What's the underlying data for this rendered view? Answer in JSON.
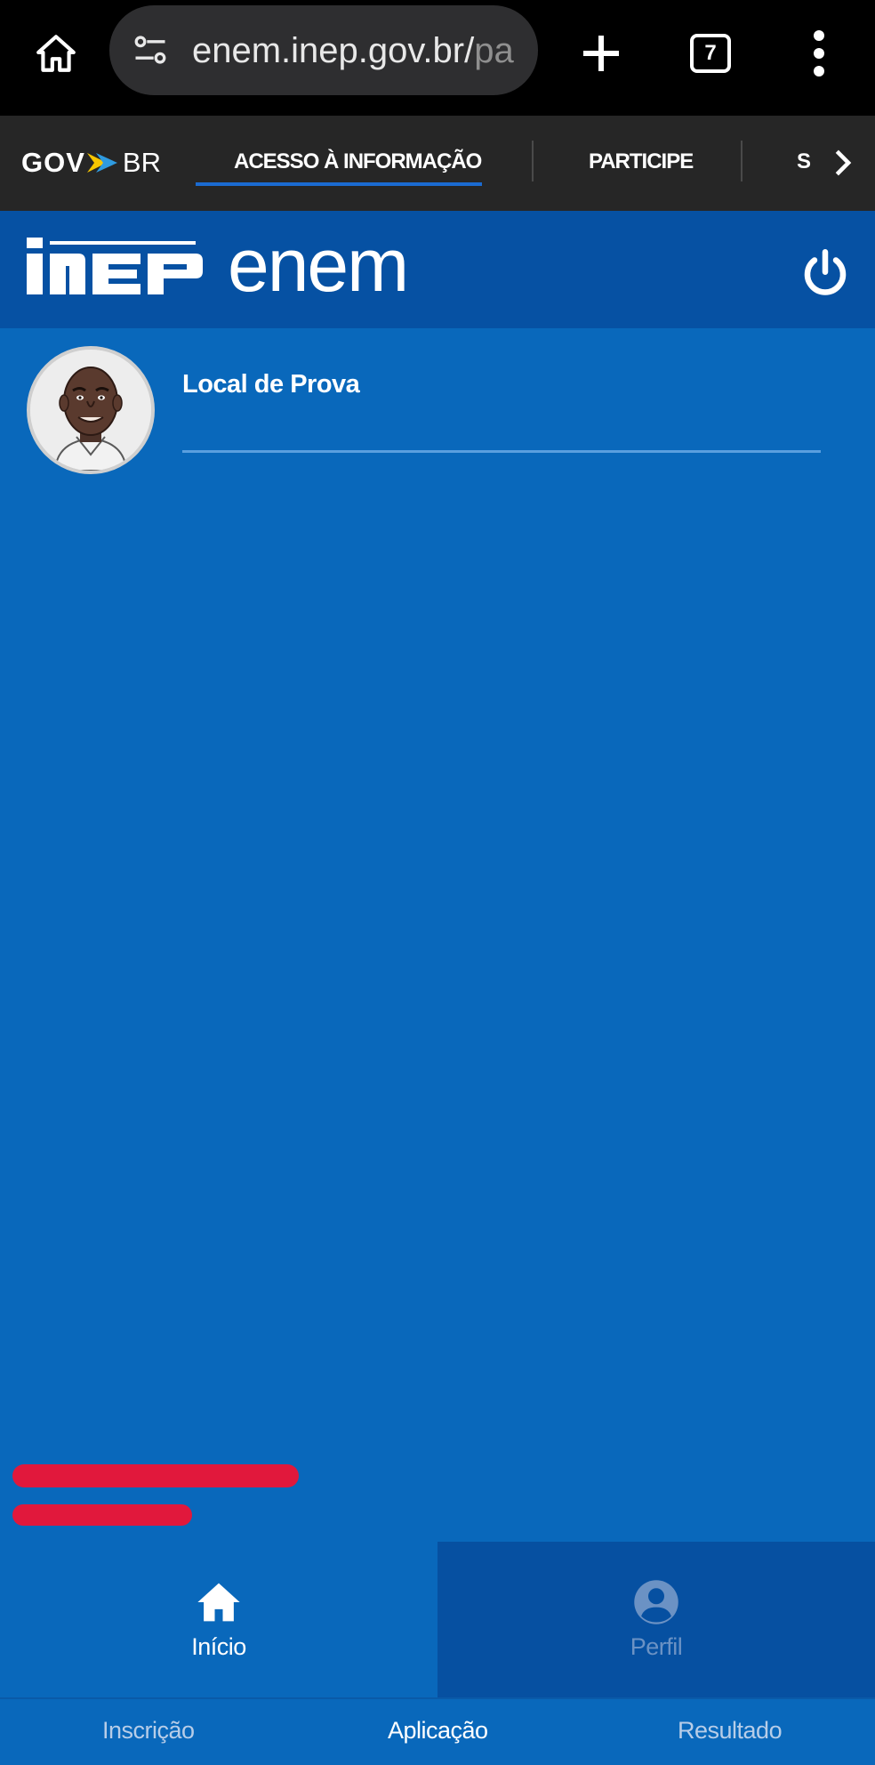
{
  "browser": {
    "url": "enem.inep.gov.br/",
    "url_tail": "pa",
    "tab_count": "7",
    "icons": [
      "home-icon",
      "tune-icon",
      "plus-icon",
      "tabs-icon",
      "more-vert-icon"
    ]
  },
  "gov_nav": {
    "logo_gov": "GOV",
    "logo_br": "BR",
    "links": [
      "ACESSO À INFORMAÇÃO",
      "PARTICIPE",
      "S"
    ]
  },
  "header": {
    "logo_inep": "INEP",
    "logo_enem": "enem"
  },
  "main": {
    "card_title": "Local de Prova"
  },
  "bottom_tabs": [
    {
      "label": "Início",
      "icon": "home-icon",
      "active": true
    },
    {
      "label": "Perfil",
      "icon": "account-circle-icon",
      "active": false
    }
  ],
  "sub_nav": [
    "Inscrição",
    "Aplicação",
    "Resultado"
  ],
  "colors": {
    "primary": "#0968bb",
    "header": "#0651a3",
    "redaction": "#e1183c"
  }
}
